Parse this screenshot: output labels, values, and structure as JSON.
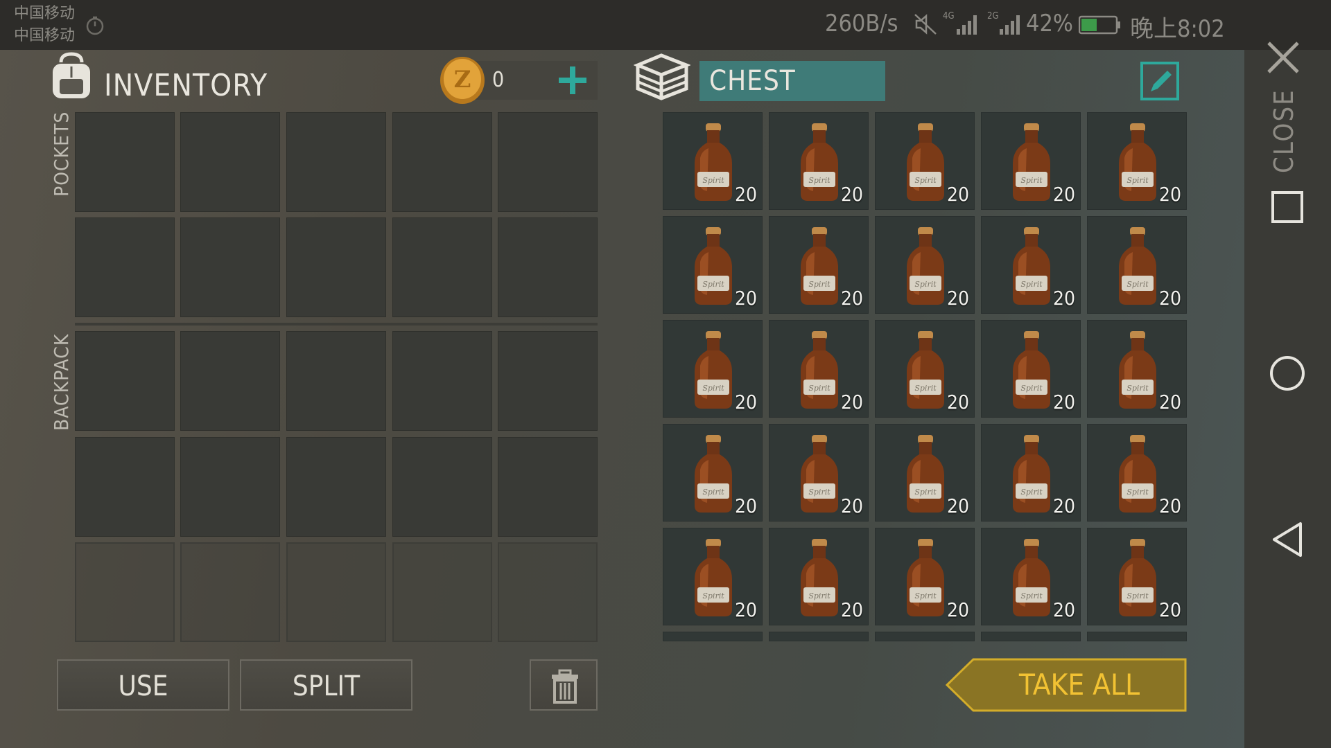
{
  "status_bar": {
    "carrier_1": "中国移动",
    "carrier_2": "中国移动",
    "speed": "260B/s",
    "net_1": "4G",
    "net_2": "2G",
    "battery": "42%",
    "time": "晚上8:02"
  },
  "inventory": {
    "title": "INVENTORY",
    "coins": "0",
    "pockets_label": "POCKETS",
    "backpack_label": "BACKPACK"
  },
  "chest": {
    "title": "CHEST",
    "bottle_label": "Spirit",
    "items": [
      {
        "qty": "20"
      },
      {
        "qty": "20"
      },
      {
        "qty": "20"
      },
      {
        "qty": "20"
      },
      {
        "qty": "20"
      },
      {
        "qty": "20"
      },
      {
        "qty": "20"
      },
      {
        "qty": "20"
      },
      {
        "qty": "20"
      },
      {
        "qty": "20"
      },
      {
        "qty": "20"
      },
      {
        "qty": "20"
      },
      {
        "qty": "20"
      },
      {
        "qty": "20"
      },
      {
        "qty": "20"
      },
      {
        "qty": "20"
      },
      {
        "qty": "20"
      },
      {
        "qty": "20"
      },
      {
        "qty": "20"
      },
      {
        "qty": "20"
      },
      {
        "qty": "20"
      },
      {
        "qty": "20"
      },
      {
        "qty": "20"
      },
      {
        "qty": "20"
      },
      {
        "qty": "20"
      }
    ]
  },
  "buttons": {
    "use": "USE",
    "split": "SPLIT",
    "take_all": "TAKE ALL",
    "close": "CLOSE"
  },
  "colors": {
    "accent_teal": "#3f7b78",
    "take_all_gold": "#8a7424",
    "take_all_text": "#f2c233"
  }
}
